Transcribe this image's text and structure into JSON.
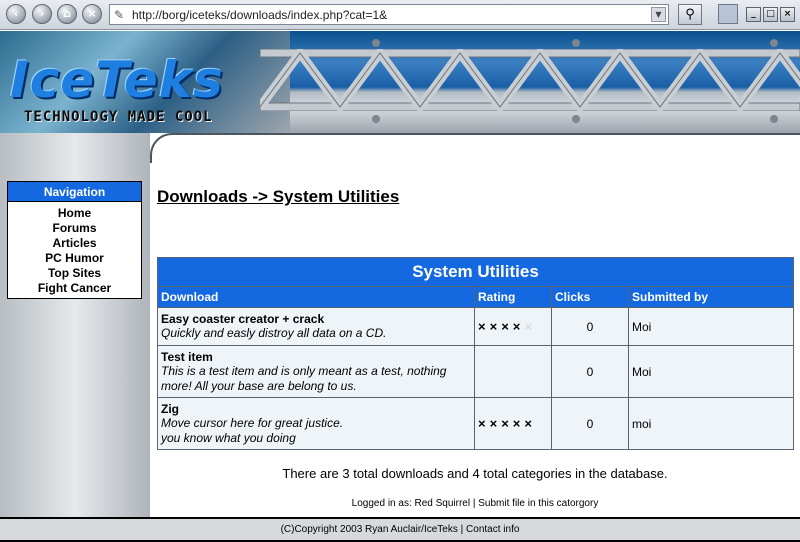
{
  "browser": {
    "url": "http://borg/iceteks/downloads/index.php?cat=1&"
  },
  "header": {
    "logo_text": "IceTeks",
    "tagline": "TECHNOLOGY MADE COOL"
  },
  "sidebar": {
    "title": "Navigation",
    "items": [
      {
        "label": "Home"
      },
      {
        "label": "Forums"
      },
      {
        "label": "Articles"
      },
      {
        "label": "PC Humor"
      },
      {
        "label": "Top Sites"
      },
      {
        "label": "Fight Cancer"
      }
    ]
  },
  "main": {
    "title": "Downloads -> System Utilities",
    "table": {
      "caption": "System Utilities",
      "columns": [
        "Download",
        "Rating",
        "Clicks",
        "Submitted by"
      ],
      "rows": [
        {
          "name": "Easy coaster creator + crack",
          "desc": "Quickly and easly distroy all data on a CD.",
          "rating": 4,
          "clicks": "0",
          "submitted_by": "Moi"
        },
        {
          "name": "Test item",
          "desc": "This is a test item and is only meant as a test, nothing more! All your base are belong to us.",
          "rating": 0,
          "clicks": "0",
          "submitted_by": "Moi"
        },
        {
          "name": "Zig",
          "desc": "Move cursor here for great justice.",
          "desc2": "you know what you doing",
          "rating": 5,
          "clicks": "0",
          "submitted_by": "moi"
        }
      ]
    },
    "summary": "There are 3 total downloads and 4 total categories in the database.",
    "login_line": {
      "logged_in_label": "Logged in as: Red Squirrel",
      "separator": "|",
      "submit_link": "Submit file in this catorgory"
    }
  },
  "footer": {
    "copyright": "(C)Copyright 2003 Ryan Auclair/IceTeks",
    "separator": "|",
    "contact_link": "Contact info"
  },
  "colors": {
    "accent_blue": "#1469e0",
    "row_bg": "#eef4f8"
  }
}
